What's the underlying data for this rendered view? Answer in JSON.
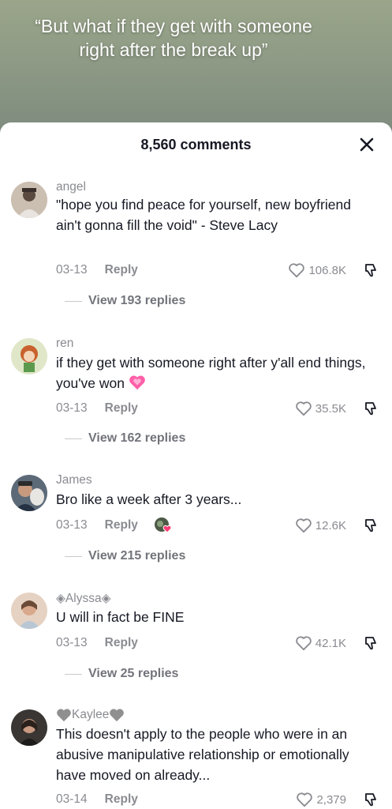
{
  "video": {
    "caption": "“But what if they get with someone right after the break up”"
  },
  "sheet": {
    "comment_count": "8,560 comments"
  },
  "comments": [
    {
      "username": "angel",
      "text": "\"hope you find peace for yourself, new boyfriend ain't gonna fill the void\" - Steve Lacy",
      "date": "03-13",
      "reply_label": "Reply",
      "likes": "106.8K",
      "view_replies": "View 193 replies"
    },
    {
      "username": "ren",
      "text": "if they get with someone right after y'all end things, you've won",
      "date": "03-13",
      "reply_label": "Reply",
      "likes": "35.5K",
      "view_replies": "View 162 replies"
    },
    {
      "username": "James",
      "text": "Bro like a week after 3 years...",
      "date": "03-13",
      "reply_label": "Reply",
      "likes": "12.6K",
      "view_replies": "View 215 replies"
    },
    {
      "username": "◈Alyssa◈",
      "text": "U will in fact be FINE",
      "date": "03-13",
      "reply_label": "Reply",
      "likes": "42.1K",
      "view_replies": "View 25 replies"
    },
    {
      "username": "Kaylee",
      "text": "This doesn't apply to the people who were in an abusive manipulative relationship or emotionally have moved on already...",
      "date": "03-14",
      "reply_label": "Reply",
      "likes": "2,379"
    }
  ],
  "colors": {
    "heart_emoji": "#ff5fa8",
    "sheet": "#ffffff",
    "muted_text": "#8a8b91"
  },
  "icons": [
    "close-icon",
    "heart-outline-icon",
    "thumbs-down-icon",
    "pink-heart-emoji",
    "grey-heart-emoji"
  ]
}
